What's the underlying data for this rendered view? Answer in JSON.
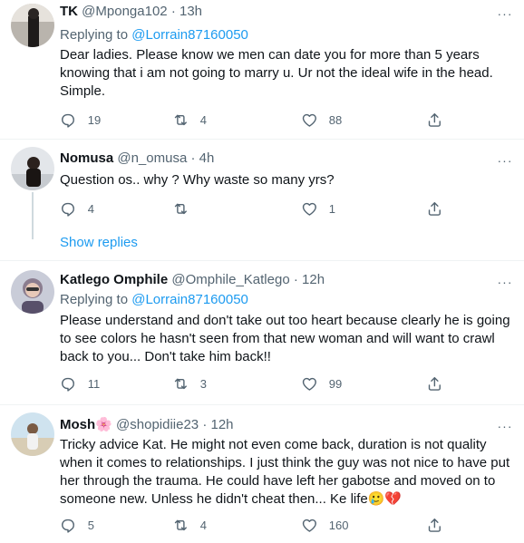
{
  "tweets": [
    {
      "name": "TK",
      "handle": "@Mponga102",
      "time": "13h",
      "replying_label": "Replying to",
      "replying_handle": "@Lorrain87160050",
      "text": "Dear ladies. Please know we men can date you for more than 5 years knowing that i am not going to marry u. Ur not the ideal wife in the head. Simple.",
      "replies": "19",
      "retweets": "4",
      "likes": "88"
    },
    {
      "name": "Nomusa",
      "handle": "@n_omusa",
      "time": "4h",
      "text": "Question os.. why ? Why waste so many yrs?",
      "replies": "4",
      "retweets": "",
      "likes": "1"
    },
    {
      "name": "Katlego Omphile",
      "handle": "@Omphile_Katlego",
      "time": "12h",
      "replying_label": "Replying to",
      "replying_handle": "@Lorrain87160050",
      "text": "Please understand and don't take out too heart because clearly he is going to see colors he hasn't seen from that new woman and will want to crawl back to you... Don't take him back!!",
      "replies": "11",
      "retweets": "3",
      "likes": "99"
    },
    {
      "name": "Mosh",
      "name_emoji": "🌸",
      "handle": "@shopidiie23",
      "time": "12h",
      "text": "Tricky advice Kat. He might not even come back, duration is not quality when it comes to relationships. I just think the guy was not nice to have put her through the trauma. He could have left her gabotse and moved on to someone new. Unless he didn't cheat then... Ke life",
      "text_emoji": "🥲💔",
      "replies": "5",
      "retweets": "4",
      "likes": "160"
    }
  ],
  "show_replies": "Show replies",
  "dot": "·",
  "more_icon": "···",
  "colors": {
    "link": "#1d9bf0",
    "muted": "#536471",
    "text": "#0f1419",
    "border": "#eff3f4"
  }
}
